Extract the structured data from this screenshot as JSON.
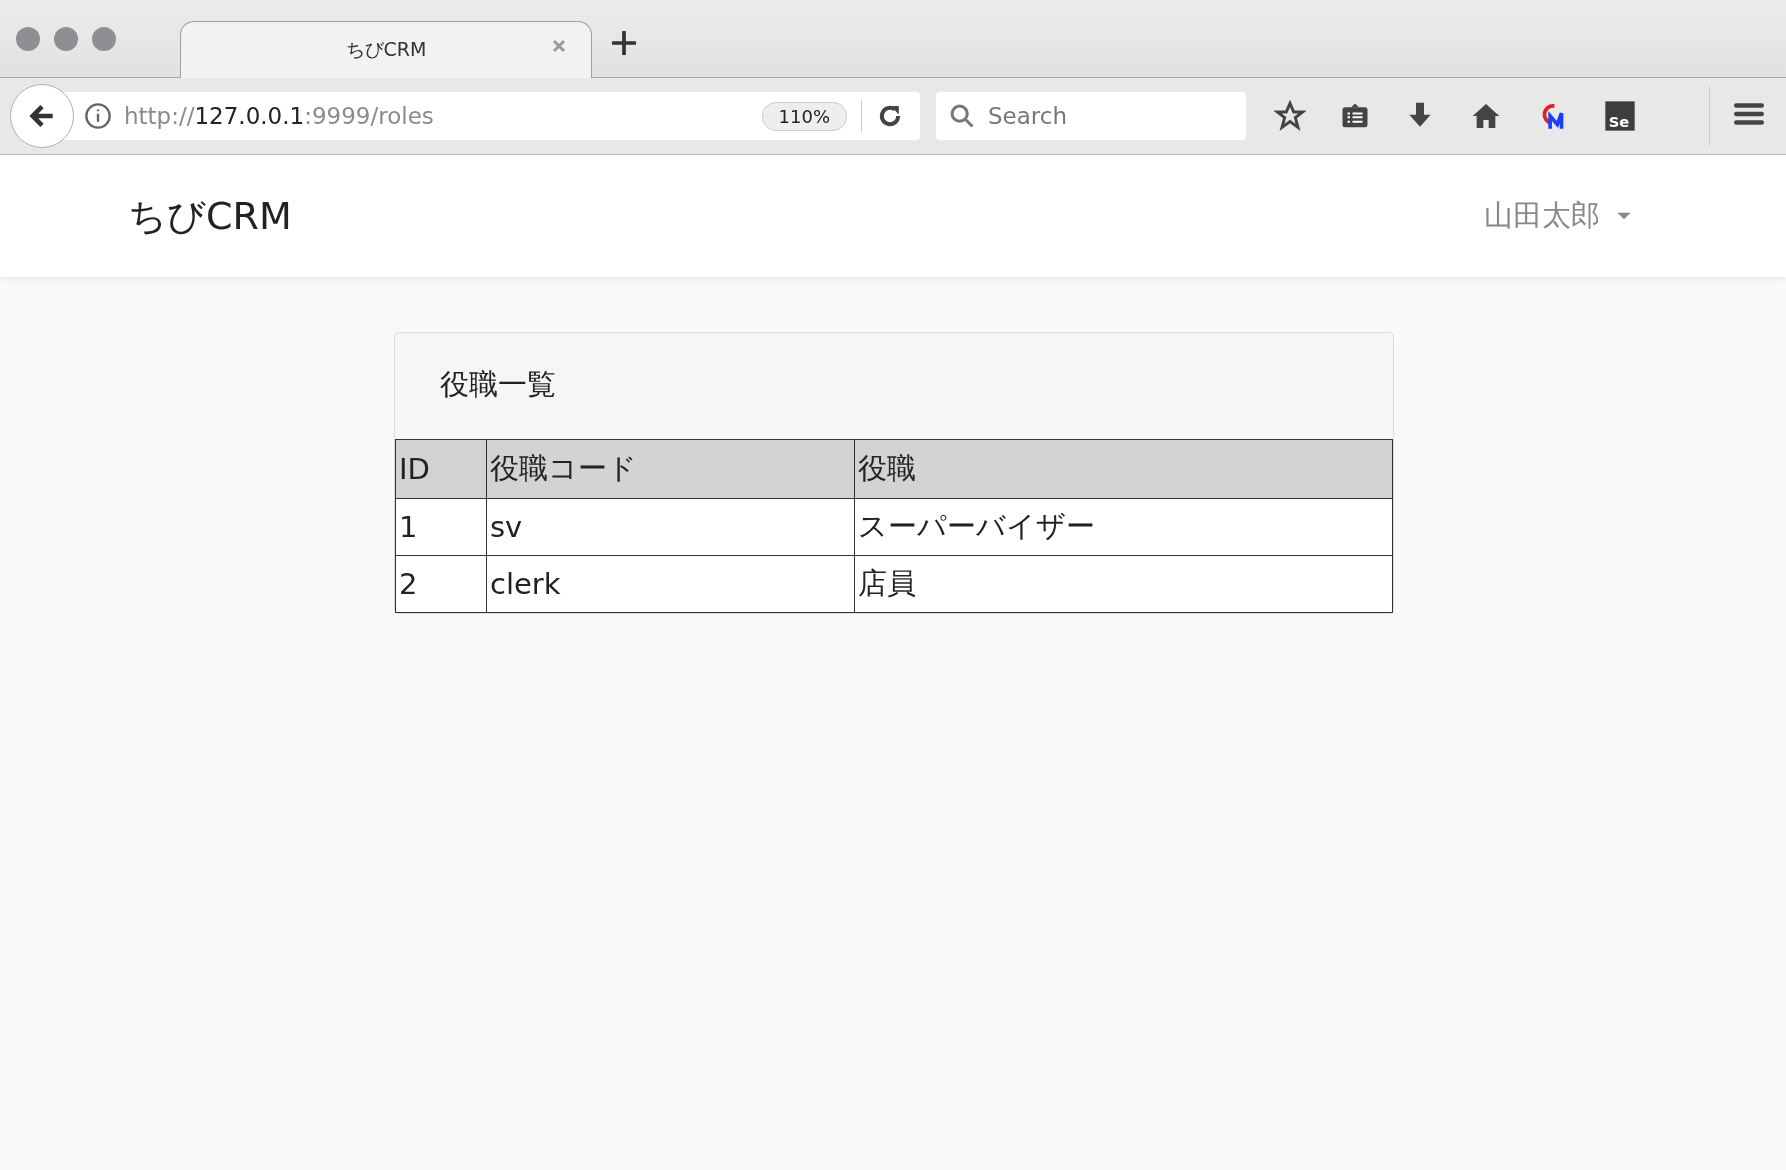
{
  "browser": {
    "tab": {
      "title": "ちびCRM",
      "selected": true
    },
    "url": {
      "scheme": "http://",
      "host": "127.0.0.1",
      "rest": ":9999/roles"
    },
    "zoom": "110%",
    "search": {
      "placeholder": "Search"
    },
    "extension_label": "Se"
  },
  "navbar": {
    "brand": "ちびCRM",
    "user": "山田太郎"
  },
  "card": {
    "title": "役職一覧",
    "table": {
      "columns": [
        "ID",
        "役職コード",
        "役職"
      ],
      "rows": [
        [
          "1",
          "sv",
          "スーパーバイザー"
        ],
        [
          "2",
          "clerk",
          "店員"
        ]
      ]
    }
  }
}
